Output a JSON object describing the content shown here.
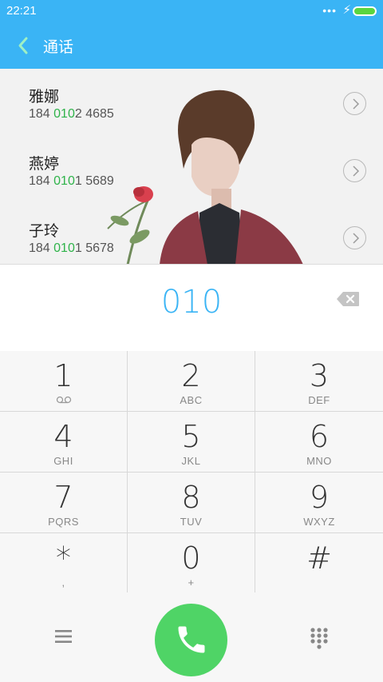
{
  "status_bar": {
    "time": "22:21",
    "indicators": "•••",
    "charging": "⚡"
  },
  "header": {
    "title": "通话",
    "back_icon": "chevron-left-icon"
  },
  "contacts": [
    {
      "name": "雅娜",
      "number_prefix": "184 ",
      "number_match": "0102",
      "number_match_hl": "010",
      "number_match_rest": "2",
      "number_suffix": " 4685"
    },
    {
      "name": "燕婷",
      "number_prefix": "184 ",
      "number_match_hl": "010",
      "number_match_rest": "1",
      "number_suffix": " 5689"
    },
    {
      "name": "子玲",
      "number_prefix": "184 ",
      "number_match_hl": "010",
      "number_match_rest": "1",
      "number_suffix": " 5678"
    }
  ],
  "display": {
    "digits": "010"
  },
  "keypad": {
    "keys": [
      {
        "num": "1",
        "sub": ""
      },
      {
        "num": "2",
        "sub": "ABC"
      },
      {
        "num": "3",
        "sub": "DEF"
      },
      {
        "num": "4",
        "sub": "GHI"
      },
      {
        "num": "5",
        "sub": "JKL"
      },
      {
        "num": "6",
        "sub": "MNO"
      },
      {
        "num": "7",
        "sub": "PQRS"
      },
      {
        "num": "8",
        "sub": "TUV"
      },
      {
        "num": "9",
        "sub": "WXYZ"
      },
      {
        "num": "*",
        "sub": ","
      },
      {
        "num": "0",
        "sub": "+"
      },
      {
        "num": "#",
        "sub": ""
      }
    ]
  },
  "colors": {
    "accent": "#3ab4f5",
    "match": "#2fb34a",
    "call": "#4fd466"
  }
}
